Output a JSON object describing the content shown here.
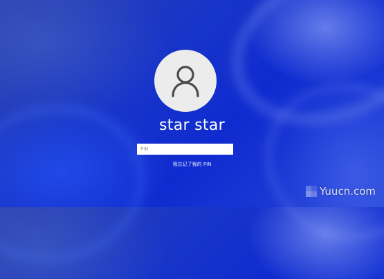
{
  "user": {
    "name": "star star",
    "avatar_icon": "user-icon"
  },
  "pin": {
    "placeholder": "PIN",
    "value": ""
  },
  "forgot_pin": {
    "label": "我忘记了我的 PIN"
  },
  "watermark": {
    "text": "Yuucn.com"
  },
  "colors": {
    "background_accent": "#1835c8",
    "avatar_bg": "#ececec",
    "text": "#ffffff"
  }
}
